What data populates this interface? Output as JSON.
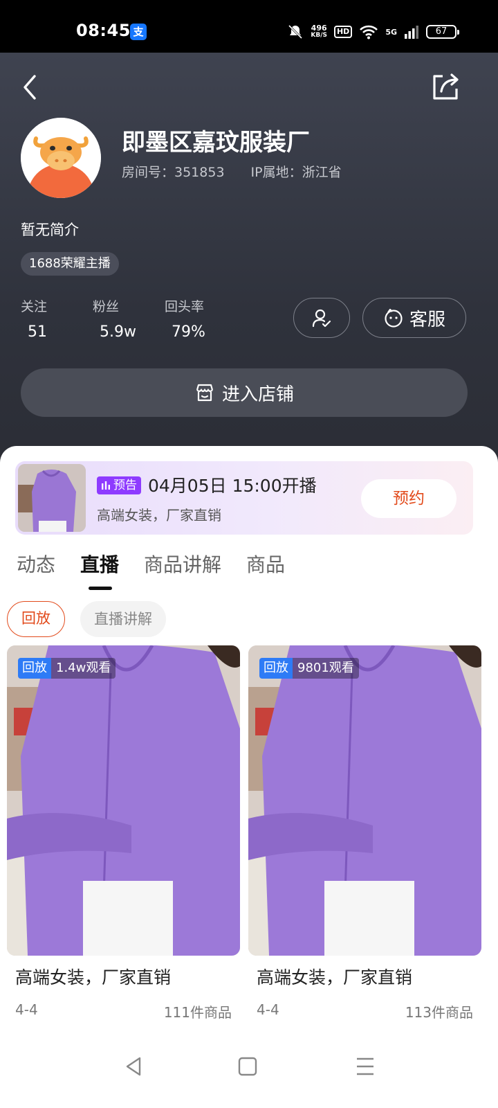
{
  "status_bar": {
    "time": "08:45",
    "alipay_icon_text": "支",
    "net_speed_value": "496",
    "net_speed_unit": "KB/S",
    "hd_label": "HD",
    "network_label": "5G",
    "battery": "67",
    "icons": [
      "alipay-icon",
      "mute-icon",
      "wifi-icon",
      "signal-icon",
      "battery-icon"
    ]
  },
  "header": {
    "icons": {
      "back": "back-arrow-icon",
      "share": "share-icon"
    },
    "shop_name": "即墨区嘉玟服装厂",
    "room_id": "房间号：351853",
    "ip_location": "IP属地：浙江省",
    "intro": "暂无简介",
    "honor_tag": "1688荣耀主播",
    "stats": [
      {
        "label": "关注",
        "value": "51"
      },
      {
        "label": "粉丝",
        "value": "5.9w"
      },
      {
        "label": "回头率",
        "value": "79%"
      }
    ],
    "service_label": "客服",
    "enter_shop_label": "进入店铺"
  },
  "preview": {
    "badge": "预告",
    "time": "04月05日 15:00开播",
    "desc": "高端女装，厂家直销",
    "reserve_label": "预约"
  },
  "tabs": [
    {
      "label": "动态",
      "active": false
    },
    {
      "label": "直播",
      "active": true
    },
    {
      "label": "商品讲解",
      "active": false
    },
    {
      "label": "商品",
      "active": false
    }
  ],
  "subtabs": [
    {
      "label": "回放",
      "active": true
    },
    {
      "label": "直播讲解",
      "active": false
    }
  ],
  "cards": [
    {
      "tag": "回放",
      "views": "1.4w观看",
      "title": "高端女装，厂家直销",
      "date": "4-4",
      "count": "111件商品"
    },
    {
      "tag": "回放",
      "views": "9801观看",
      "title": "高端女装，厂家直销",
      "date": "4-4",
      "count": "113件商品"
    }
  ],
  "colors": {
    "accent": "#e24a1b",
    "preview_badge": "#8e3bff",
    "replay_tag": "#2e7bf6",
    "header_bg": "#353844"
  }
}
